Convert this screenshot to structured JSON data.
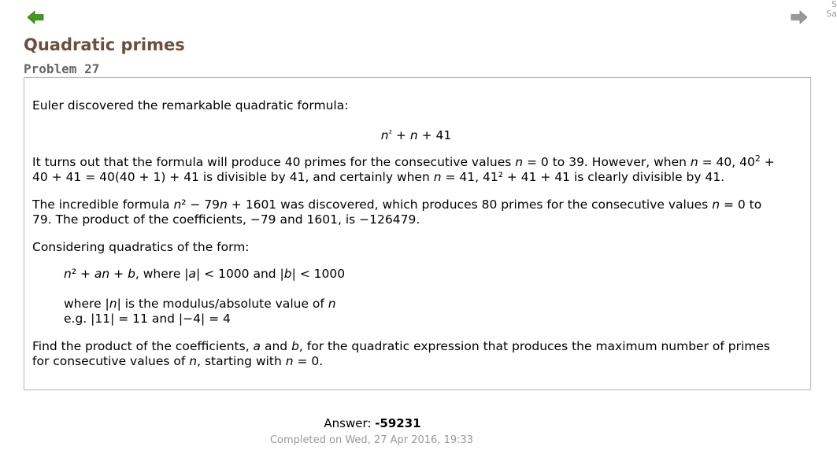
{
  "corner": {
    "text": "S\nSa"
  },
  "problem": {
    "title": "Quadratic primes",
    "number_label": "Problem 27"
  },
  "content": {
    "p1": "Euler discovered the remarkable quadratic formula:",
    "formula1": {
      "a": "n",
      "b": "²",
      "c": " + ",
      "d": "n",
      "e": " + 41"
    },
    "p2": {
      "line1_a": "It turns out that the formula will produce 40 primes for the consecutive values ",
      "n1": "n",
      "line1_b": " = 0 to 39. However, when ",
      "n2": "n",
      "line1_c": " = 40, 40",
      "sup": "2",
      "line1_d": " +",
      "line2_a": "40 + 41 = 40(40 + 1) + 41 is divisible by 41, and certainly when ",
      "n3": "n",
      "line2_b": " = 41, 41² + 41 + 41 is clearly divisible by 41."
    },
    "p3": {
      "line1_a": "The incredible formula  ",
      "n1": "n",
      "line1_b": "² − 79",
      "n2": "n",
      "line1_c": " + 1601 was discovered, which produces 80 primes for the consecutive values ",
      "n3": "n",
      "line1_d": " = 0 to",
      "line2": "79. The product of the coefficients, −79 and 1601, is −126479."
    },
    "p4": "Considering quadratics of the form:",
    "form": {
      "n1": "n",
      "t1": "² + ",
      "a": "an",
      "t2": " + ",
      "b": "b",
      "t3": ", where |",
      "a2": "a",
      "t4": "| < 1000 and |",
      "b2": "b",
      "t5": "| < 1000"
    },
    "where": {
      "t1": "where |",
      "n": "n",
      "t2": "| is the modulus/absolute value of ",
      "n2": "n"
    },
    "eg": "e.g. |11| = 11 and |−4| = 4",
    "p5": {
      "line1_a": "Find the product of the coefficients, ",
      "a": "a",
      "line1_b": " and ",
      "b": "b",
      "line1_c": ", for the quadratic expression that produces the maximum number of primes",
      "line2_a": "for consecutive values of ",
      "n1": "n",
      "line2_b": ", starting with ",
      "n2": "n",
      "line2_c": " = 0."
    }
  },
  "answer": {
    "label": "Answer: ",
    "value": "-59231"
  },
  "completed": "Completed on Wed, 27 Apr 2016, 19:33",
  "icons": {
    "back": "left-arrow-icon",
    "next": "right-arrow-icon",
    "back_color": "#3d9a1a",
    "next_color": "#9a9a9a"
  }
}
